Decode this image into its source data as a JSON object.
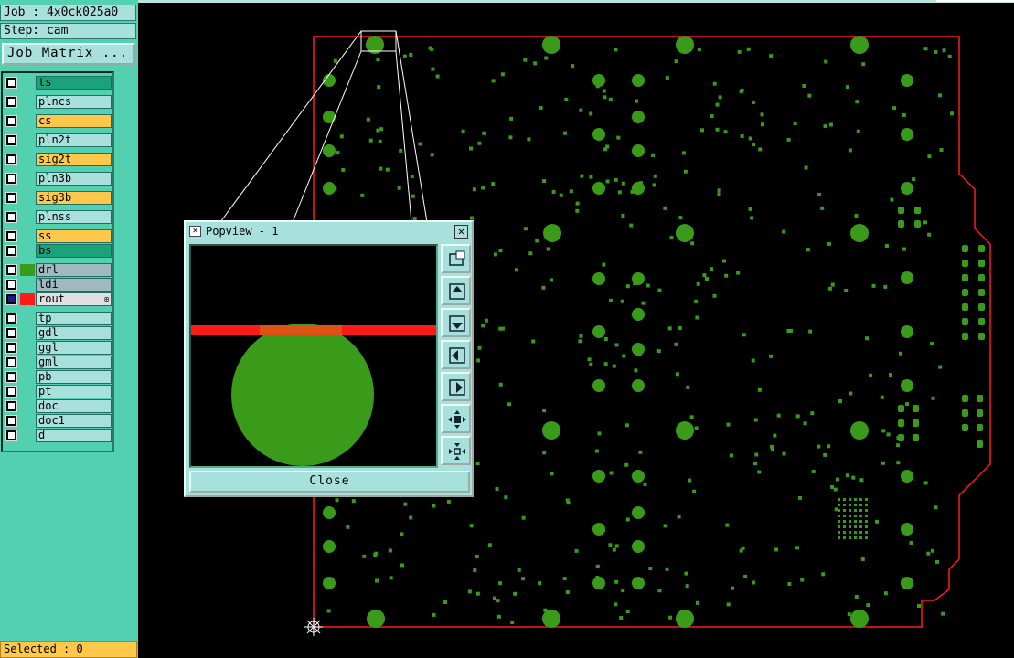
{
  "header": {
    "job_label": "Job : 4x0ck025a0",
    "step_label": "Step: cam",
    "job_matrix_button": "Job Matrix ..."
  },
  "layers": [
    {
      "name": "ts",
      "bg": "#1aa37a",
      "swatch": "",
      "active": false
    },
    {
      "name": "plncs",
      "bg": "#a8e0dc",
      "swatch": "",
      "active": false
    },
    {
      "name": "cs",
      "bg": "#ffc84a",
      "swatch": "",
      "active": false
    },
    {
      "name": "pln2t",
      "bg": "#a8e0dc",
      "swatch": "",
      "active": false
    },
    {
      "name": "sig2t",
      "bg": "#ffc84a",
      "swatch": "",
      "active": false
    },
    {
      "name": "pln3b",
      "bg": "#a8e0dc",
      "swatch": "",
      "active": false
    },
    {
      "name": "sig3b",
      "bg": "#ffc84a",
      "swatch": "",
      "active": false
    },
    {
      "name": "plnss",
      "bg": "#a8e0dc",
      "swatch": "",
      "active": false
    },
    {
      "name": "ss",
      "bg": "#ffc84a",
      "swatch": "",
      "active": false
    },
    {
      "name": "bs",
      "bg": "#1aa37a",
      "swatch": "",
      "active": false
    },
    {
      "name": "drl",
      "bg": "#a0b8c0",
      "swatch": "#3a9a1a",
      "active": false
    },
    {
      "name": "ldi",
      "bg": "#a0b8c0",
      "swatch": "",
      "active": false
    },
    {
      "name": "rout",
      "bg": "#e0e0e0",
      "swatch": "#ff1a1a",
      "active": true,
      "marker": "⊞"
    },
    {
      "name": "tp",
      "bg": "#a8e0dc",
      "swatch": "",
      "active": false
    },
    {
      "name": "gdl",
      "bg": "#a8e0dc",
      "swatch": "",
      "active": false
    },
    {
      "name": "ggl",
      "bg": "#a8e0dc",
      "swatch": "",
      "active": false
    },
    {
      "name": "gml",
      "bg": "#a8e0dc",
      "swatch": "",
      "active": false
    },
    {
      "name": "pb",
      "bg": "#a8e0dc",
      "swatch": "",
      "active": false
    },
    {
      "name": "pt",
      "bg": "#a8e0dc",
      "swatch": "",
      "active": false
    },
    {
      "name": "doc",
      "bg": "#a8e0dc",
      "swatch": "",
      "active": false
    },
    {
      "name": "doc1",
      "bg": "#a8e0dc",
      "swatch": "",
      "active": false
    },
    {
      "name": "d",
      "bg": "#a8e0dc",
      "swatch": "",
      "active": false
    }
  ],
  "status": {
    "selected": "Selected : 0"
  },
  "popview": {
    "title": "Popview - 1",
    "close_label": "Close",
    "close_x": "✕",
    "tools": [
      {
        "icon": "zoom-fit-icon"
      },
      {
        "icon": "pan-up-icon"
      },
      {
        "icon": "pan-down-icon"
      },
      {
        "icon": "pan-left-icon"
      },
      {
        "icon": "pan-right-icon"
      },
      {
        "icon": "zoom-in-icon"
      },
      {
        "icon": "zoom-out-icon"
      }
    ]
  },
  "colors": {
    "pad": "#3a9a1a",
    "outline": "#ff1a1a",
    "panel": "#53d0b0",
    "field": "#a8e0dc",
    "highlight": "#ffc84a"
  }
}
